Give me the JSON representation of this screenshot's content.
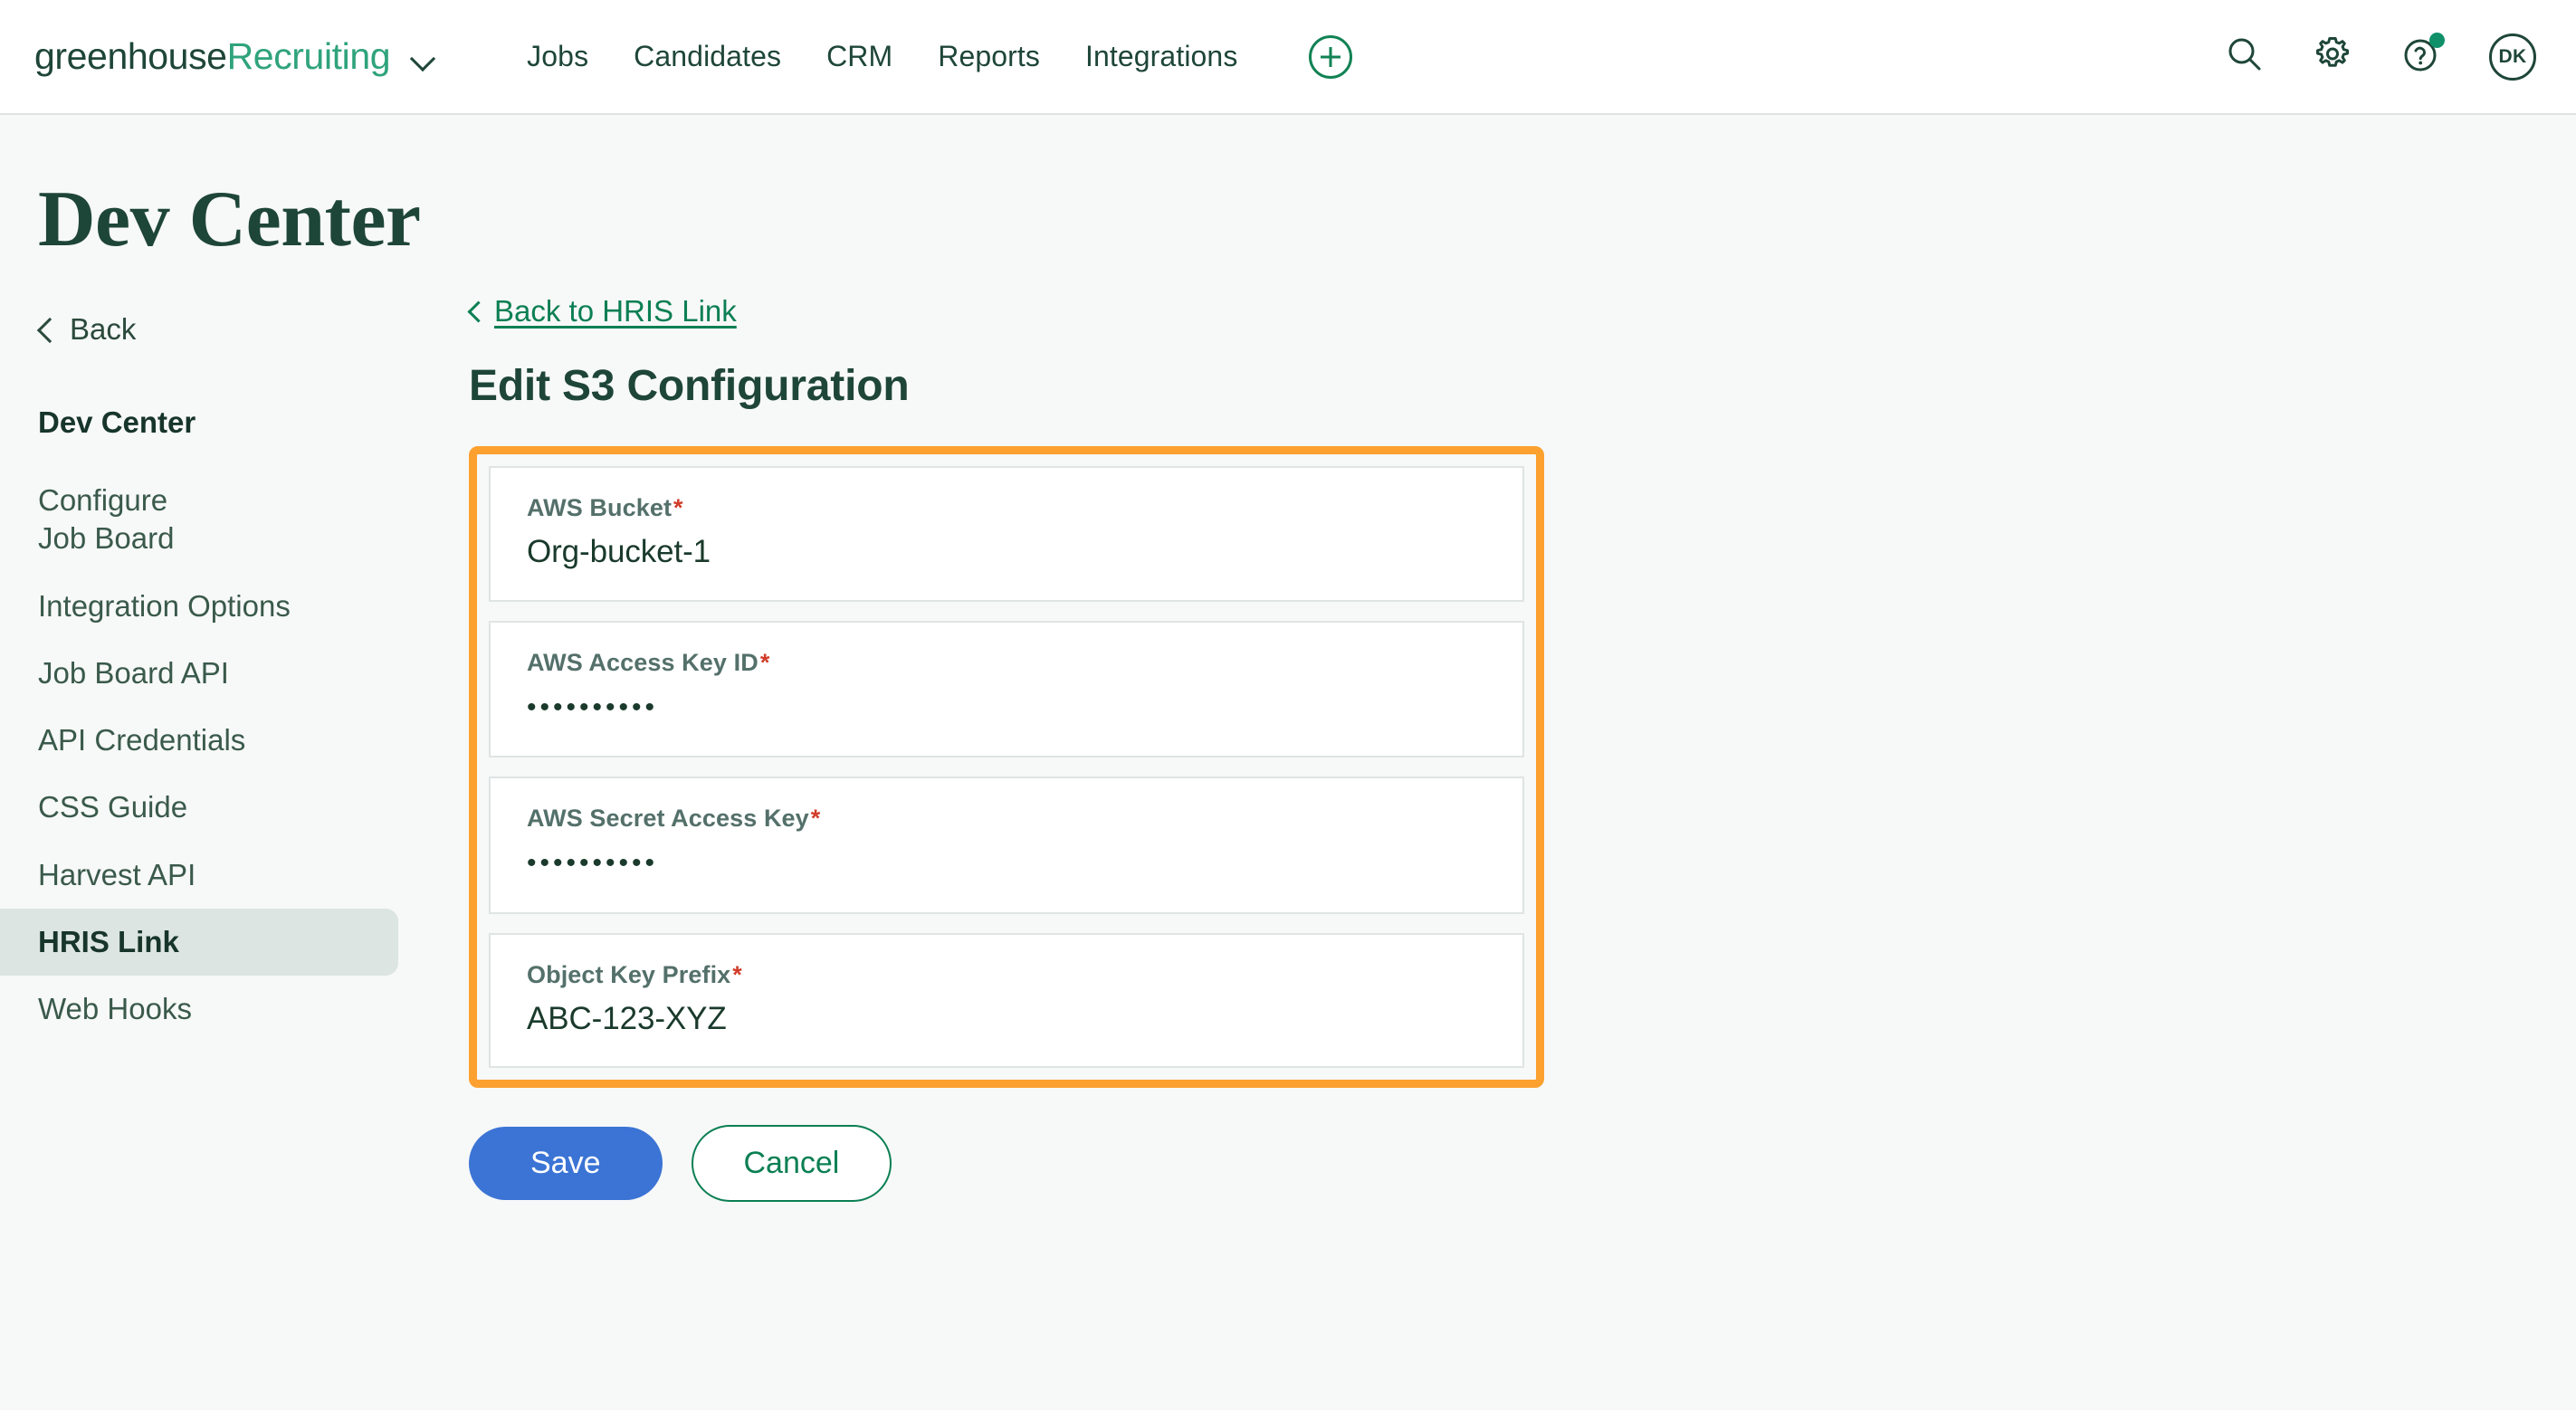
{
  "header": {
    "brand_primary": "greenhouse",
    "brand_secondary": "Recruiting",
    "nav_links": [
      {
        "label": "Jobs"
      },
      {
        "label": "Candidates"
      },
      {
        "label": "CRM"
      },
      {
        "label": "Reports"
      },
      {
        "label": "Integrations"
      }
    ],
    "avatar_initials": "DK",
    "icons": {
      "brand_dropdown": "chevron-down-icon",
      "add": "plus-circle-icon",
      "search": "search-icon",
      "settings": "gear-icon",
      "help": "question-circle-icon",
      "avatar": "avatar"
    },
    "colors": {
      "brand_dark_green": "#1E4638",
      "brand_accent_green": "#2FA37C",
      "notification_dot": "#0F9069"
    }
  },
  "page": {
    "title": "Dev Center"
  },
  "sidebar": {
    "back_label": "Back",
    "items": [
      {
        "label": "Dev Center",
        "state": "heading"
      },
      {
        "label": "Configure Job Board",
        "state": "default"
      },
      {
        "label": "Integration Options",
        "state": "default"
      },
      {
        "label": "Job Board API",
        "state": "default"
      },
      {
        "label": "API Credentials",
        "state": "default"
      },
      {
        "label": "CSS Guide",
        "state": "default"
      },
      {
        "label": "Harvest API",
        "state": "default"
      },
      {
        "label": "HRIS Link",
        "state": "active"
      },
      {
        "label": "Web Hooks",
        "state": "default"
      }
    ],
    "active_item": "HRIS Link",
    "active_background": "#DCE5E1"
  },
  "main": {
    "breadcrumb_label": "Back to HRIS Link",
    "section_title": "Edit S3 Configuration",
    "highlight_border_color": "#FCA02F",
    "required_marker": "*",
    "fields": [
      {
        "label": "AWS Bucket",
        "value": "Org-bucket-1",
        "required": true,
        "masked": false
      },
      {
        "label": "AWS Access Key ID",
        "value": "••••••••••",
        "required": true,
        "masked": true
      },
      {
        "label": "AWS Secret Access Key",
        "value": "••••••••••",
        "required": true,
        "masked": true
      },
      {
        "label": "Object Key Prefix",
        "value": "ABC-123-XYZ",
        "required": true,
        "masked": false
      }
    ],
    "save_label": "Save",
    "cancel_label": "Cancel",
    "save_color": "#3B74D5",
    "cancel_color": "#0B7F53"
  }
}
